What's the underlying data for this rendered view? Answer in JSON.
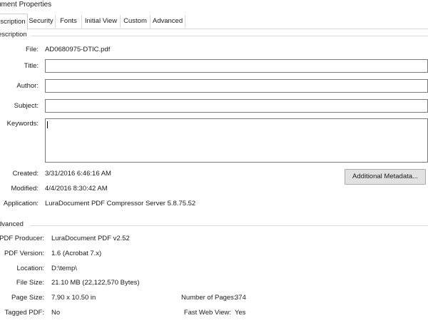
{
  "window": {
    "title": "ument Properties"
  },
  "tabs": [
    {
      "label": "scription"
    },
    {
      "label": "Security"
    },
    {
      "label": "Fonts"
    },
    {
      "label": "Initial View"
    },
    {
      "label": "Custom"
    },
    {
      "label": "Advanced"
    }
  ],
  "description": {
    "section_label": "escription",
    "file_label": "File:",
    "file_value": "AD0680975-DTIC.pdf",
    "title_label": "Title:",
    "title_value": "",
    "author_label": "Author:",
    "author_value": "",
    "subject_label": "Subject:",
    "subject_value": "",
    "keywords_label": "Keywords:",
    "keywords_value": "",
    "created_label": "Created:",
    "created_value": "3/31/2016 6:46:16 AM",
    "modified_label": "Modified:",
    "modified_value": "4/4/2016 8:30:42 AM",
    "application_label": "Application:",
    "application_value": "LuraDocument PDF Compressor Server 5.8.75.52",
    "additional_metadata_button": "Additional Metadata..."
  },
  "advanced": {
    "section_label": "dvanced",
    "pdf_producer_label": "PDF Producer:",
    "pdf_producer_value": "LuraDocument PDF v2.52",
    "pdf_version_label": "PDF Version:",
    "pdf_version_value": "1.6 (Acrobat 7.x)",
    "location_label": "Location:",
    "location_value": "D:\\temp\\",
    "file_size_label": "File Size:",
    "file_size_value": "21.10 MB (22,122,570 Bytes)",
    "page_size_label": "Page Size:",
    "page_size_value": "7.90 x 10.50 in",
    "num_pages_label": "Number of Pages:",
    "num_pages_value": "374",
    "tagged_pdf_label": "Tagged PDF:",
    "tagged_pdf_value": "No",
    "fast_web_view_label": "Fast Web View:",
    "fast_web_view_value": "Yes"
  }
}
